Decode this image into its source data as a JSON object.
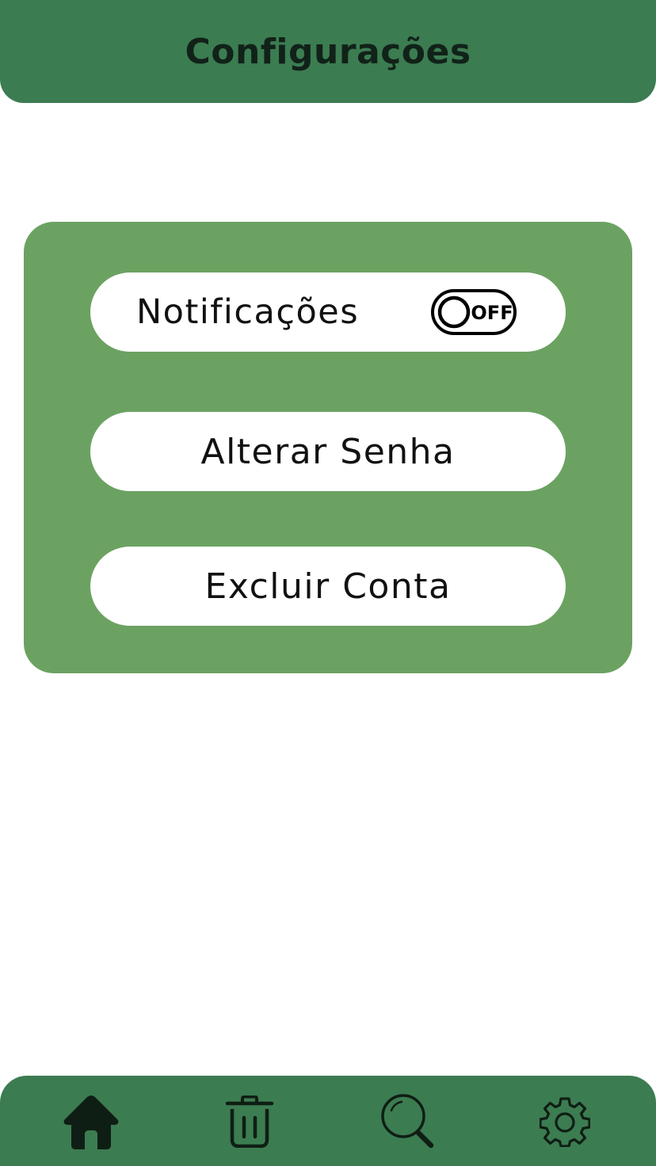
{
  "header": {
    "title": "Configurações"
  },
  "settings": {
    "notifications_label": "Notificações",
    "notifications_toggle": {
      "state_text": "OFF",
      "enabled": false
    },
    "change_password_label": "Alterar Senha",
    "delete_account_label": "Excluir Conta"
  },
  "nav": {
    "items": [
      {
        "icon": "home-icon"
      },
      {
        "icon": "trash-icon"
      },
      {
        "icon": "search-icon"
      },
      {
        "icon": "gear-icon"
      }
    ]
  },
  "colors": {
    "header_green": "#3c7c51",
    "panel_green": "#6ba262",
    "icon_dark": "#0f1e14"
  }
}
